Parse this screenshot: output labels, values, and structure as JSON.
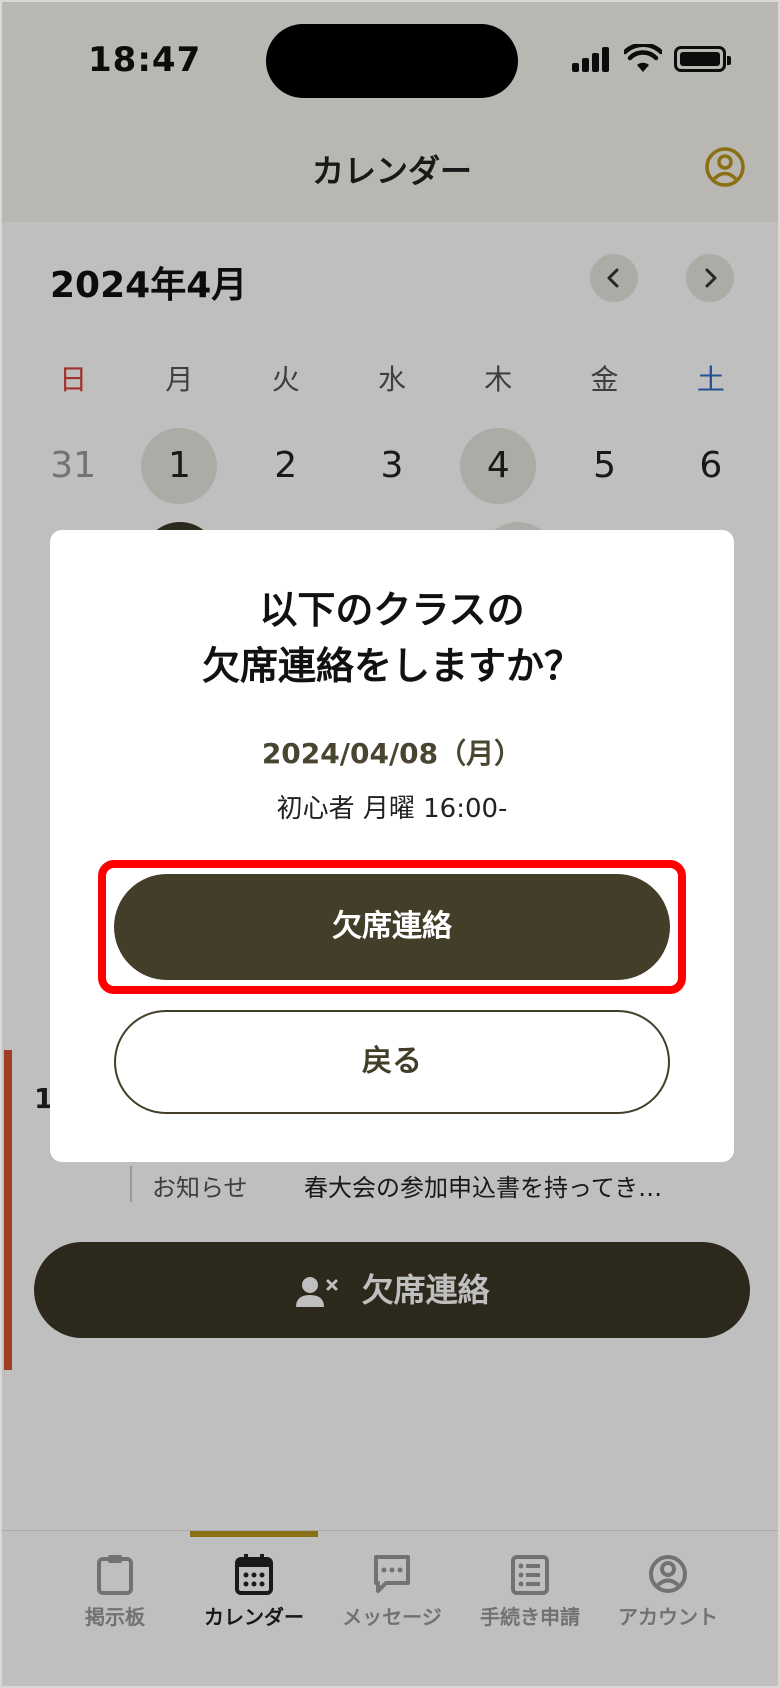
{
  "status_bar": {
    "time": "18:47"
  },
  "header": {
    "title": "カレンダー"
  },
  "calendar": {
    "month": "2024年4月",
    "weekdays": [
      "日",
      "月",
      "火",
      "水",
      "木",
      "金",
      "土"
    ],
    "week1": [
      "31",
      "1",
      "2",
      "3",
      "4",
      "5",
      "6"
    ]
  },
  "schedule": {
    "time_partial": "1",
    "notice_label": "お知らせ",
    "notice_text": "春大会の参加申込書を持ってき…",
    "absent_button_label": "欠席連絡"
  },
  "tabs": [
    {
      "label": "掲示板",
      "icon": "clipboard-icon"
    },
    {
      "label": "カレンダー",
      "icon": "calendar-icon",
      "active": true
    },
    {
      "label": "メッセージ",
      "icon": "message-icon"
    },
    {
      "label": "手続き申請",
      "icon": "list-icon"
    },
    {
      "label": "アカウント",
      "icon": "account-icon"
    }
  ],
  "modal": {
    "title_line1": "以下のクラスの",
    "title_line2": "欠席連絡をしますか？",
    "date": "2024/04/08（月）",
    "class_info": "初心者 月曜 16:00-",
    "confirm_label": "欠席連絡",
    "back_label": "戻る"
  },
  "colors": {
    "primary": "#433e2a",
    "accent": "#b8941a",
    "highlight": "#ff0000",
    "sunday": "#d8443a",
    "saturday": "#2c6cc4"
  }
}
